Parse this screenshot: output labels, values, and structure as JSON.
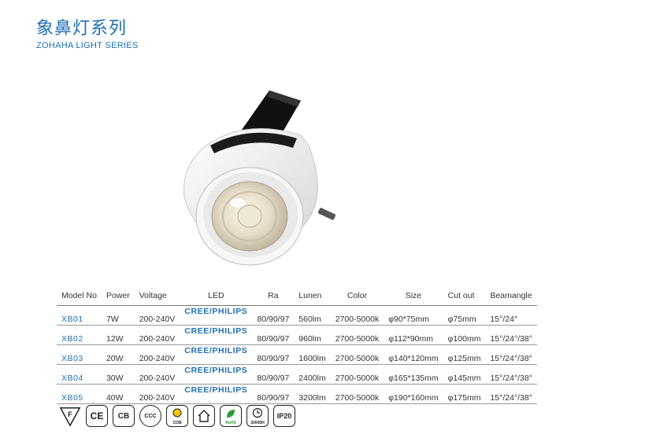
{
  "header": {
    "title_cn": "象鼻灯系列",
    "title_en": "ZOHAHA LIGHT SERIES"
  },
  "table": {
    "headers": [
      "Model No",
      "Power",
      "Voltage",
      "LED",
      "Ra",
      "Lunen",
      "Color",
      "Size",
      "Cut out",
      "Beamangle"
    ],
    "rows": [
      [
        "XB01",
        "7W",
        "200-240V",
        "CREE/PHILIPS",
        "80/90/97",
        "560lm",
        "2700-5000k",
        "φ90*75mm",
        "φ75mm",
        "15°/24°"
      ],
      [
        "XB02",
        "12W",
        "200-240V",
        "CREE/PHILIPS",
        "80/90/97",
        "960lm",
        "2700-5000k",
        "φ112*90mm",
        "φ100mm",
        "15°/24°/38°"
      ],
      [
        "XB03",
        "20W",
        "200-240V",
        "CREE/PHILIPS",
        "80/90/97",
        "1600lm",
        "2700-5000k",
        "φ140*120mm",
        "φ125mm",
        "15°/24°/38°"
      ],
      [
        "XB04",
        "30W",
        "200-240V",
        "CREE/PHILIPS",
        "80/90/97",
        "2400lm",
        "2700-5000k",
        "φ165*135mm",
        "φ145mm",
        "15°/24°/38°"
      ],
      [
        "XB05",
        "40W",
        "200-240V",
        "CREE/PHILIPS",
        "80/90/97",
        "3200lm",
        "2700-5000k",
        "φ190*160mm",
        "φ175mm",
        "15°/24°/38°"
      ]
    ]
  },
  "certifications": {
    "f_mark": "F",
    "ce": "CE",
    "cb": "CB",
    "ccc": "CCC",
    "cob": "COB",
    "rohs": "RoHS",
    "lifetime": "30000H",
    "ip": "IP20"
  },
  "colors": {
    "accent": "#1f6fb4"
  }
}
